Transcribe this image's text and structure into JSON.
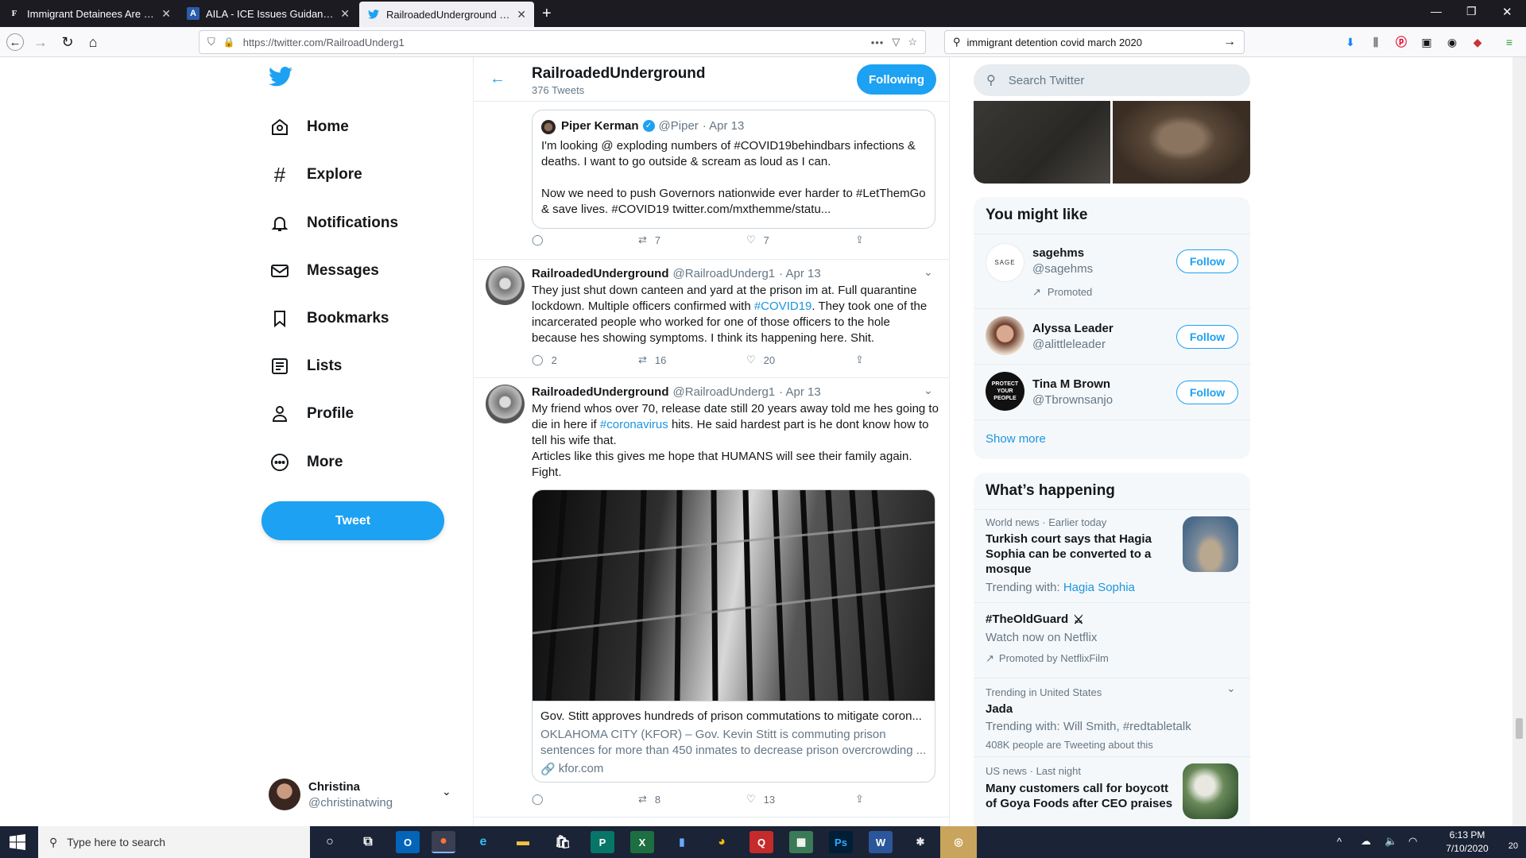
{
  "browser": {
    "tabs": [
      {
        "label": "Immigrant Detainees Are Sitting",
        "favicon": "F"
      },
      {
        "label": "AILA - ICE Issues Guidance on C",
        "favicon": "A"
      },
      {
        "label": "RailroadedUnderground (@Rai",
        "favicon": "t"
      }
    ],
    "url": "https://twitter.com/RailroadUnderg1",
    "search_query": "immigrant detention covid march 2020"
  },
  "sidebar": {
    "items": [
      {
        "label": "Home",
        "icon": "home-icon"
      },
      {
        "label": "Explore",
        "icon": "hashtag-icon"
      },
      {
        "label": "Notifications",
        "icon": "bell-icon"
      },
      {
        "label": "Messages",
        "icon": "envelope-icon"
      },
      {
        "label": "Bookmarks",
        "icon": "bookmark-icon"
      },
      {
        "label": "Lists",
        "icon": "list-icon"
      },
      {
        "label": "Profile",
        "icon": "person-icon"
      },
      {
        "label": "More",
        "icon": "more-icon"
      }
    ],
    "tweet_button": "Tweet",
    "account": {
      "name": "Christina",
      "handle": "@christinatwing"
    }
  },
  "header": {
    "name": "RailroadedUnderground",
    "tweet_count": "376 Tweets",
    "following_button": "Following"
  },
  "quoted_tweet": {
    "author": "Piper Kerman",
    "handle": "@Piper",
    "date": "· Apr 13",
    "line1": "I'm looking @ exploding numbers of #COVID19behindbars infections &",
    "line2": "deaths. I want to go outside & scream as loud as I can.",
    "line3": "Now we need to push Governors nationwide ever harder to #LetThemGo",
    "line4": "& save lives. #COVID19 twitter.com/mxthemme/statu...",
    "retweets": "7",
    "likes": "7"
  },
  "tweets": [
    {
      "author": "RailroadedUnderground",
      "handle": "@RailroadUnderg1",
      "date": "· Apr 13",
      "line1": "They just shut down canteen and yard at the prison im at. Full quarantine",
      "line2a": "lockdown. Multiple officers confirmed with ",
      "line2_tag": "#COVID19",
      "line2b": ". They took one of the",
      "line3": "incarcerated people who worked for one of those officers to the hole",
      "line4": "because hes showing symptoms. I think its happening here. Shit.",
      "replies": "2",
      "retweets": "16",
      "likes": "20"
    },
    {
      "author": "RailroadedUnderground",
      "handle": "@RailroadUnderg1",
      "date": "· Apr 13",
      "line1": "My friend whos over 70, release date still 20 years away told me hes going to",
      "line2a": "die in here if ",
      "line2_tag": "#coronavirus",
      "line2b": " hits. He said hardest part is he dont know how to",
      "line3": "tell his wife that.",
      "line4": "Articles like this gives me hope that HUMANS will see their family again.",
      "line5": "Fight.",
      "card_title": "Gov. Stitt approves hundreds of prison commutations to mitigate coron...",
      "card_desc1": "OKLAHOMA CITY (KFOR) – Gov. Kevin Stitt is commuting prison",
      "card_desc2": "sentences for more than 450 inmates to decrease prison overcrowding ...",
      "card_domain": "kfor.com",
      "retweets": "8",
      "likes": "13"
    }
  ],
  "right": {
    "search_placeholder": "Search Twitter",
    "you_might_like": {
      "title": "You might like",
      "accounts": [
        {
          "name": "sagehms",
          "handle": "@sagehms",
          "promoted": "Promoted",
          "button": "Follow",
          "avatar_text": "SAGE"
        },
        {
          "name": "Alyssa Leader",
          "handle": "@alittleleader",
          "button": "Follow"
        },
        {
          "name": "Tina M Brown",
          "handle": "@Tbrownsanjo",
          "button": "Follow",
          "avatar_text": "PROTECT YOUR PEOPLE"
        }
      ],
      "show_more": "Show more"
    },
    "whats_happening": {
      "title": "What’s happening",
      "items": [
        {
          "meta": "World news · Earlier today",
          "headline1": "Turkish court says that Hagia",
          "headline2": "Sophia can be converted to a",
          "headline3": "mosque",
          "trending_prefix": "Trending with: ",
          "trending_link": "Hagia Sophia"
        },
        {
          "tag": "#TheOldGuard",
          "sub": "Watch now on Netflix",
          "promoted": "Promoted by NetflixFilm"
        },
        {
          "meta": "Trending in United States",
          "headline1": "Jada",
          "sub": "Trending with: Will Smith, #redtabletalk",
          "count": "408K people are Tweeting about this"
        },
        {
          "meta": "US news · Last night",
          "headline1": "Many customers call for boycott",
          "headline2": "of Goya Foods after CEO praises"
        }
      ]
    }
  },
  "taskbar": {
    "search_placeholder": "Type here to search",
    "time": "6:13 PM",
    "date": "7/10/2020",
    "notification_count": "20"
  },
  "colors": {
    "twitter_blue": "#1da1f2",
    "link_blue": "#1b95e0",
    "taskbar": "#1b2336",
    "tabbar": "#1c1b22"
  }
}
